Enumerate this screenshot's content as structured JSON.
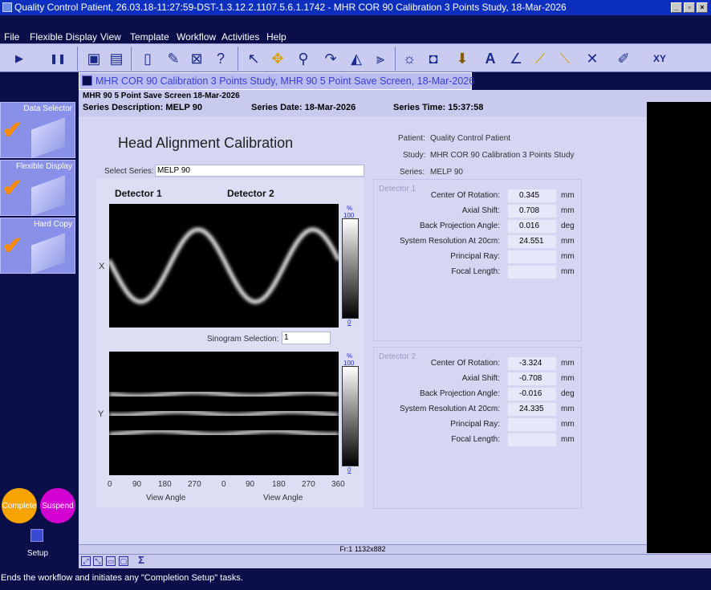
{
  "window": {
    "title": "Quality Control Patient, 26.03.18-11:27:59-DST-1.3.12.2.1107.5.6.1.1742 - MHR COR 90 Calibration 3 Points Study, 18-Mar-2026"
  },
  "menu": {
    "file": "File",
    "flexible_display": "Flexible Display",
    "view": "View",
    "template": "Template",
    "workflow": "Workflow",
    "activities": "Activities",
    "help": "Help"
  },
  "toolbar": {
    "icons": [
      "play-icon",
      "pause-icon",
      "save-icon",
      "print-icon",
      "new-icon",
      "edit-icon",
      "delete-icon",
      "help-icon",
      "pointer-icon",
      "brightness-icon",
      "zoom-icon",
      "rotate-icon",
      "flip-icon",
      "align-icon",
      "window-icon",
      "frame-icon",
      "arrow-icon",
      "text-icon",
      "angle-icon",
      "ruler-icon",
      "measure-icon",
      "tool-icon",
      "pen-icon",
      "xy-icon"
    ]
  },
  "left_panel": {
    "tiles": [
      {
        "label": "Data Selector"
      },
      {
        "label": "Flexible Display"
      },
      {
        "label": "Hard Copy"
      }
    ],
    "complete": "Complete",
    "suspend": "Suspend",
    "setup": "Setup"
  },
  "doc_tab": {
    "title": "MHR COR 90 Calibration 3 Points Study, MHR 90 5 Point Save Screen, 18-Mar-2026"
  },
  "header": {
    "screen_title": "MHR 90 5 Point Save Screen 18-Mar-2026",
    "series_description": "Series Description: MELP 90",
    "series_date": "Series Date: 18-Mar-2026",
    "series_time": "Series Time: 15:37:58"
  },
  "main": {
    "heading": "Head Alignment Calibration",
    "select_series_label": "Select Series:",
    "select_series_value": "MELP 90",
    "patient_label": "Patient:",
    "patient_value": "Quality Control Patient",
    "study_label": "Study:",
    "study_value": "MHR COR 90 Calibration 3 Points Study",
    "series_label": "Series:",
    "series_value": "MELP 90",
    "detector1_title": "Detector 1",
    "detector2_title": "Detector 2",
    "x_label": "X",
    "y_label": "Y",
    "cbar_pct": "%",
    "cbar_max": "100",
    "cbar_min": "0",
    "sinogram_label": "Sinogram Selection:",
    "sinogram_value": "1",
    "x_ticks": [
      "0",
      "90",
      "180",
      "270",
      "0",
      "90",
      "180",
      "270",
      "360"
    ],
    "view_angle_1": "View Angle",
    "view_angle_2": "View Angle"
  },
  "detector1": {
    "title": "Detector 1",
    "rows": [
      {
        "label": "Center Of Rotation:",
        "value": "0.345",
        "unit": "mm"
      },
      {
        "label": "Axial Shift:",
        "value": "0.708",
        "unit": "mm"
      },
      {
        "label": "Back Projection Angle:",
        "value": "0.016",
        "unit": "deg"
      },
      {
        "label": "System Resolution At 20cm:",
        "value": "24.551",
        "unit": "mm"
      },
      {
        "label": "Principal Ray:",
        "value": "",
        "unit": "mm"
      },
      {
        "label": "Focal Length:",
        "value": "",
        "unit": "mm"
      }
    ]
  },
  "detector2": {
    "title": "Detector 2",
    "rows": [
      {
        "label": "Center Of Rotation:",
        "value": "-3.324",
        "unit": "mm"
      },
      {
        "label": "Axial Shift:",
        "value": "-0.708",
        "unit": "mm"
      },
      {
        "label": "Back Projection Angle:",
        "value": "-0.016",
        "unit": "deg"
      },
      {
        "label": "System Resolution At 20cm:",
        "value": "24.335",
        "unit": "mm"
      },
      {
        "label": "Principal Ray:",
        "value": "",
        "unit": "mm"
      },
      {
        "label": "Focal Length:",
        "value": "",
        "unit": "mm"
      }
    ]
  },
  "frame_info": "Fr:1 1132x882",
  "status": "Ends the workflow and initiates any \"Completion Setup\" tasks."
}
